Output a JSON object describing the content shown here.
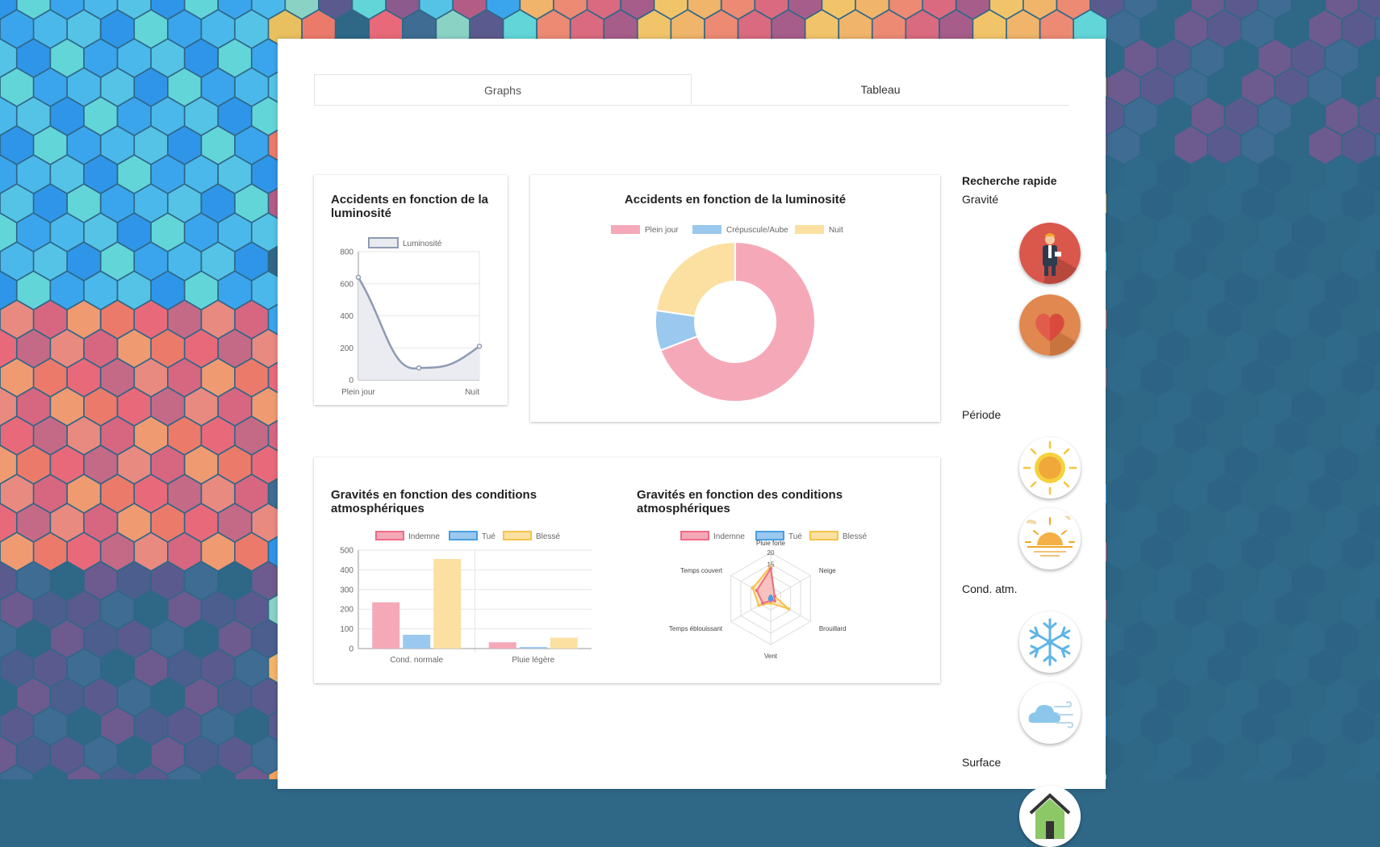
{
  "tabs": [
    {
      "label": "Graphs",
      "active": true
    },
    {
      "label": "Tableau",
      "active": false
    }
  ],
  "cards": {
    "line": {
      "title": "Accidents en fonction de la luminosité"
    },
    "doughnut": {
      "title": "Accidents en fonction de la luminosité"
    },
    "bar": {
      "title": "Gravités en fonction des conditions atmosphériques"
    },
    "radar": {
      "title": "Gravités en fonction des conditions atmosphériques"
    }
  },
  "sidebar": {
    "title": "Recherche rapide",
    "sections": {
      "gravite": "Gravité",
      "periode": "Période",
      "cond": "Cond. atm.",
      "surface": "Surface"
    },
    "icons": [
      "injured-person-icon",
      "heart-icon",
      "sun-icon",
      "sunset-icon",
      "snowflake-icon",
      "wind-cloud-icon",
      "house-icon"
    ]
  },
  "colors": {
    "pink": "#f5a9b8",
    "blue": "#9ac8ee",
    "yellow": "#fbe0a2",
    "line": "#8e9ab3"
  },
  "chart_data": [
    {
      "id": "line",
      "type": "line",
      "title": "Accidents en fonction de la luminosité",
      "categories": [
        "Plein jour",
        "",
        "Nuit"
      ],
      "series": [
        {
          "name": "Luminosité",
          "values": [
            640,
            75,
            210
          ]
        }
      ],
      "ylim": [
        0,
        800
      ],
      "yticks": [
        0,
        200,
        400,
        600,
        800
      ],
      "legend": "top"
    },
    {
      "id": "doughnut",
      "type": "pie",
      "title": "Accidents en fonction de la luminosité",
      "categories": [
        "Plein jour",
        "Crépuscule/Aube",
        "Nuit"
      ],
      "values": [
        640,
        75,
        210
      ],
      "legend": "top"
    },
    {
      "id": "bar",
      "type": "bar",
      "title": "Gravités en fonction des conditions atmosphériques",
      "categories": [
        "Cond. normale",
        "Pluie légère"
      ],
      "series": [
        {
          "name": "Indemne",
          "values": [
            235,
            32
          ]
        },
        {
          "name": "Tué",
          "values": [
            70,
            8
          ]
        },
        {
          "name": "Blessé",
          "values": [
            455,
            55
          ]
        }
      ],
      "ylim": [
        0,
        500
      ],
      "yticks": [
        0,
        100,
        200,
        300,
        400,
        500
      ],
      "legend": "top"
    },
    {
      "id": "radar",
      "type": "radar",
      "title": "Gravités en fonction des conditions atmosphériques",
      "categories": [
        "Pluie forte",
        "Neige",
        "Brouillard",
        "Vent",
        "Temps éblouissant",
        "Temps couvert"
      ],
      "series": [
        {
          "name": "Indemne",
          "values": [
            13,
            2,
            2,
            1,
            4,
            7
          ]
        },
        {
          "name": "Tué",
          "values": [
            1,
            0.5,
            0.5,
            0.5,
            0.5,
            0.5
          ]
        },
        {
          "name": "Blessé",
          "values": [
            14,
            2,
            9,
            2,
            6,
            9
          ]
        }
      ],
      "rlim": [
        0,
        20
      ],
      "rticks": [
        15,
        20
      ],
      "legend": "top"
    }
  ]
}
